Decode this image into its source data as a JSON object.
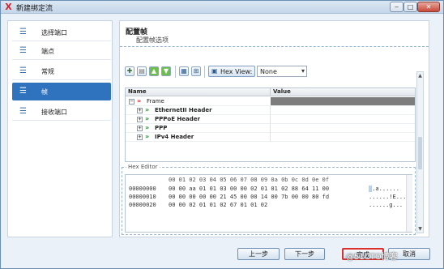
{
  "window": {
    "title": "新建绑定流",
    "app_icon_glyph": "X",
    "min_glyph": "‒",
    "max_glyph": "□",
    "close_glyph": "✕"
  },
  "sidebar": {
    "items": [
      {
        "label": "选择端口",
        "icon": "list-icon",
        "active": false
      },
      {
        "label": "端点",
        "icon": "list-icon",
        "active": false
      },
      {
        "label": "常规",
        "icon": "list-icon",
        "active": false
      },
      {
        "label": "帧",
        "icon": "list-icon",
        "active": true
      },
      {
        "label": "接收端口",
        "icon": "list-icon",
        "active": false
      }
    ]
  },
  "content": {
    "title": "配置帧",
    "subtitle": "配置帧选项"
  },
  "toolbar": {
    "hex_view_label": "Hex View:",
    "hex_select_value": "None"
  },
  "tree": {
    "col_name": "Name",
    "col_value": "Value",
    "rows": [
      {
        "label": "Frame",
        "bold": false,
        "expander": "−"
      },
      {
        "label": "EthernetII Header",
        "bold": true,
        "expander": "+"
      },
      {
        "label": "PPPoE Header",
        "bold": true,
        "expander": "+"
      },
      {
        "label": "PPP",
        "bold": true,
        "expander": "+"
      },
      {
        "label": "IPv4 Header",
        "bold": true,
        "expander": "+"
      }
    ]
  },
  "hex_editor": {
    "title": "Hex Editor",
    "columns": "00 01 02 03 04 05 06 07 08 09 0a 0b 0c 0d 0e 0f",
    "lines": [
      {
        "offset": "00000000",
        "bytes": "00 00 aa 01 01 03 00 00 02 01 01 02 88 64 11 00",
        "ascii": ".a......"
      },
      {
        "offset": "00000010",
        "bytes": "00 00 00 00 00 21 45 00 00 14 00 7b 00 00 80 fd",
        "ascii": "......!E..."
      },
      {
        "offset": "00000020",
        "bytes": "00 00 02 01 01 02 67 01 01 02",
        "ascii": "......g..."
      }
    ]
  },
  "buttons": {
    "prev": "上一步",
    "next": "下一步",
    "finish": "完成",
    "cancel": "取消"
  },
  "watermark": "@51CTO博客",
  "colors": {
    "accent": "#2f73bf",
    "finish_outline": "#d9302c",
    "frame_value_bg": "#7d7d7d",
    "tree_arrow_frame": "#d0343a",
    "tree_arrow_child": "#2e8b3a"
  }
}
